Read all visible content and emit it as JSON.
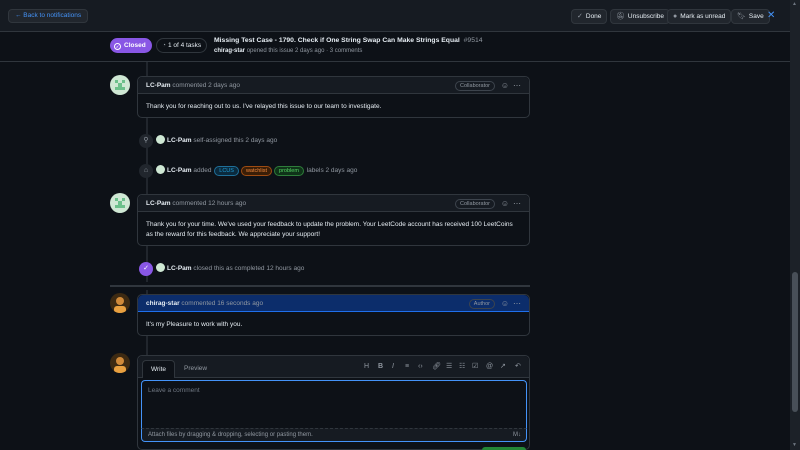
{
  "topbar": {
    "back_label": "← Back to notifications",
    "done_label": "Done",
    "unsubscribe_label": "Unsubscribe",
    "mark_unread_label": "Mark as unread",
    "save_label": "Save",
    "close_glyph": "✕"
  },
  "issue": {
    "state": "Closed",
    "tasks": "1 of 4 tasks",
    "title": "Missing Test Case - 1790. Check if One String Swap Can Make Strings Equal",
    "number": "#9514",
    "author": "chirag-star",
    "meta_rest": "opened this issue 2 days ago · 3 comments"
  },
  "timeline": {
    "c1": {
      "author": "LC-Pam",
      "action": "commented 2 days ago",
      "role": "Collaborator",
      "body": "Thank you for reaching out to us. I've relayed this issue to our team to investigate."
    },
    "e1": {
      "actor": "LC-Pam",
      "text": "self-assigned this 2 days ago"
    },
    "e2": {
      "actor": "LC-Pam",
      "added": "added",
      "labels": [
        {
          "name": "LCUS",
          "color": "#1f9ed8"
        },
        {
          "name": "watchlist",
          "color": "#e36209"
        },
        {
          "name": "problem",
          "color": "#3fb950"
        }
      ],
      "suffix": "labels 2 days ago"
    },
    "c2": {
      "author": "LC-Pam",
      "action": "commented 12 hours ago",
      "role": "Collaborator",
      "body": "Thank you for your time. We've used your feedback to update the problem. Your LeetCode account has received 100 LeetCoins as the reward for this feedback. We appreciate your support!"
    },
    "e3": {
      "actor": "LC-Pam",
      "text": "closed this as completed 12 hours ago"
    },
    "c3": {
      "author": "chirag-star",
      "action": "commented 16 seconds ago",
      "role": "Author",
      "body": "It's my Pleasure to work with you."
    }
  },
  "editor": {
    "tab_write": "Write",
    "tab_preview": "Preview",
    "placeholder": "Leave a comment",
    "attach_text": "Attach files by dragging & dropping, selecting or pasting them."
  },
  "colors": {
    "accent": "#4493f8",
    "closed": "#8957e5",
    "bg": "#0d1117"
  }
}
